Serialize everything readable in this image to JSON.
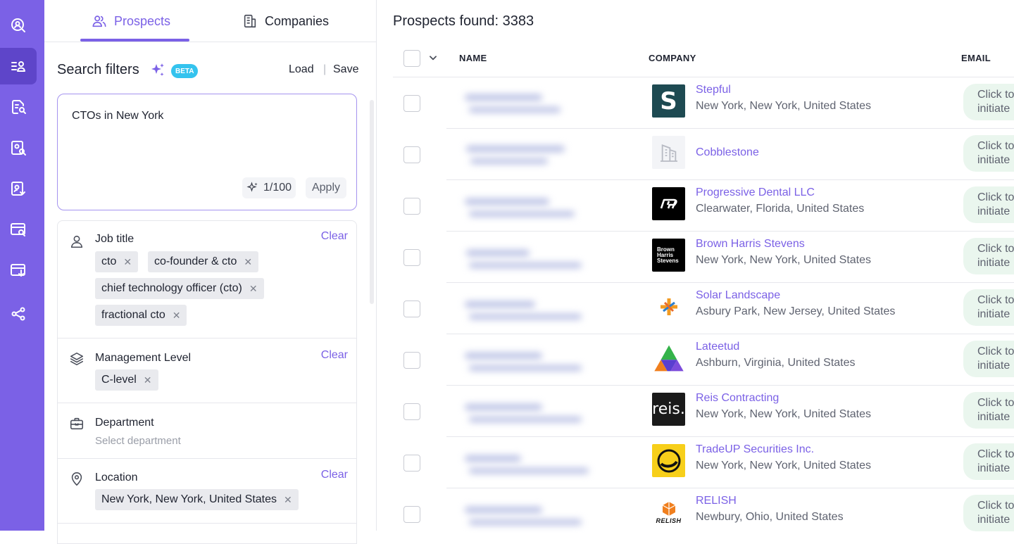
{
  "rail": {
    "items": [
      {
        "icon": "search-people-icon",
        "active": false
      },
      {
        "icon": "prospects-list-icon",
        "active": true
      },
      {
        "icon": "document-search-icon",
        "active": false
      },
      {
        "icon": "person-search-icon",
        "active": false
      },
      {
        "icon": "person-download-icon",
        "active": false
      },
      {
        "icon": "browser-search-icon",
        "active": false
      },
      {
        "icon": "browser-download-icon",
        "active": false
      },
      {
        "icon": "share-nodes-icon",
        "active": false
      }
    ]
  },
  "tabs": {
    "prospects": "Prospects",
    "companies": "Companies"
  },
  "filters_header": {
    "title": "Search filters",
    "beta": "BETA",
    "load": "Load",
    "separator": "|",
    "save": "Save"
  },
  "prompt": {
    "text": "CTOs in New York",
    "counter": "1/100",
    "apply": "Apply"
  },
  "filters": {
    "job_title": {
      "label": "Job title",
      "clear": "Clear",
      "chips": [
        "cto",
        "co-founder & cto",
        "chief technology officer (cto)",
        "fractional cto"
      ]
    },
    "management_level": {
      "label": "Management Level",
      "clear": "Clear",
      "chips": [
        "C-level"
      ]
    },
    "department": {
      "label": "Department",
      "placeholder": "Select department"
    },
    "location": {
      "label": "Location",
      "clear": "Clear",
      "chips": [
        "New York, New York, United States"
      ]
    }
  },
  "results": {
    "found": "Prospects found: 3383",
    "columns": {
      "name": "NAME",
      "company": "COMPANY",
      "email": "EMAIL"
    },
    "rows": [
      {
        "company": "Stepful",
        "location": "New York, New York, United States",
        "email": "Click to initiate"
      },
      {
        "company": "Cobblestone",
        "location": "",
        "email": "Click to initiate"
      },
      {
        "company": "Progressive Dental LLC",
        "location": "Clearwater, Florida, United States",
        "email": "Click to initiate"
      },
      {
        "company": "Brown Harris Stevens",
        "location": "New York, New York, United States",
        "email": "Click to initiate"
      },
      {
        "company": "Solar Landscape",
        "location": "Asbury Park, New Jersey, United States",
        "email": "Click to initiate"
      },
      {
        "company": "Lateetud",
        "location": "Ashburn, Virginia, United States",
        "email": "Click to initiate"
      },
      {
        "company": "Reis Contracting",
        "location": "New York, New York, United States",
        "email": "Click to initiate"
      },
      {
        "company": "TradeUP Securities Inc.",
        "location": "New York, New York, United States",
        "email": "Click to initiate"
      },
      {
        "company": "RELISH",
        "location": "Newbury, Ohio, United States",
        "email": "Click to initiate"
      }
    ],
    "logos": {
      "stepful": "S",
      "brown_harris": "Brown Harris Stevens",
      "reis": "reis.",
      "relish": "RELISH"
    }
  },
  "colors": {
    "accent": "#7b61e6",
    "rail": "#7b61e6",
    "beta": "#34c3ee",
    "email_bg": "#eaf6ee"
  }
}
